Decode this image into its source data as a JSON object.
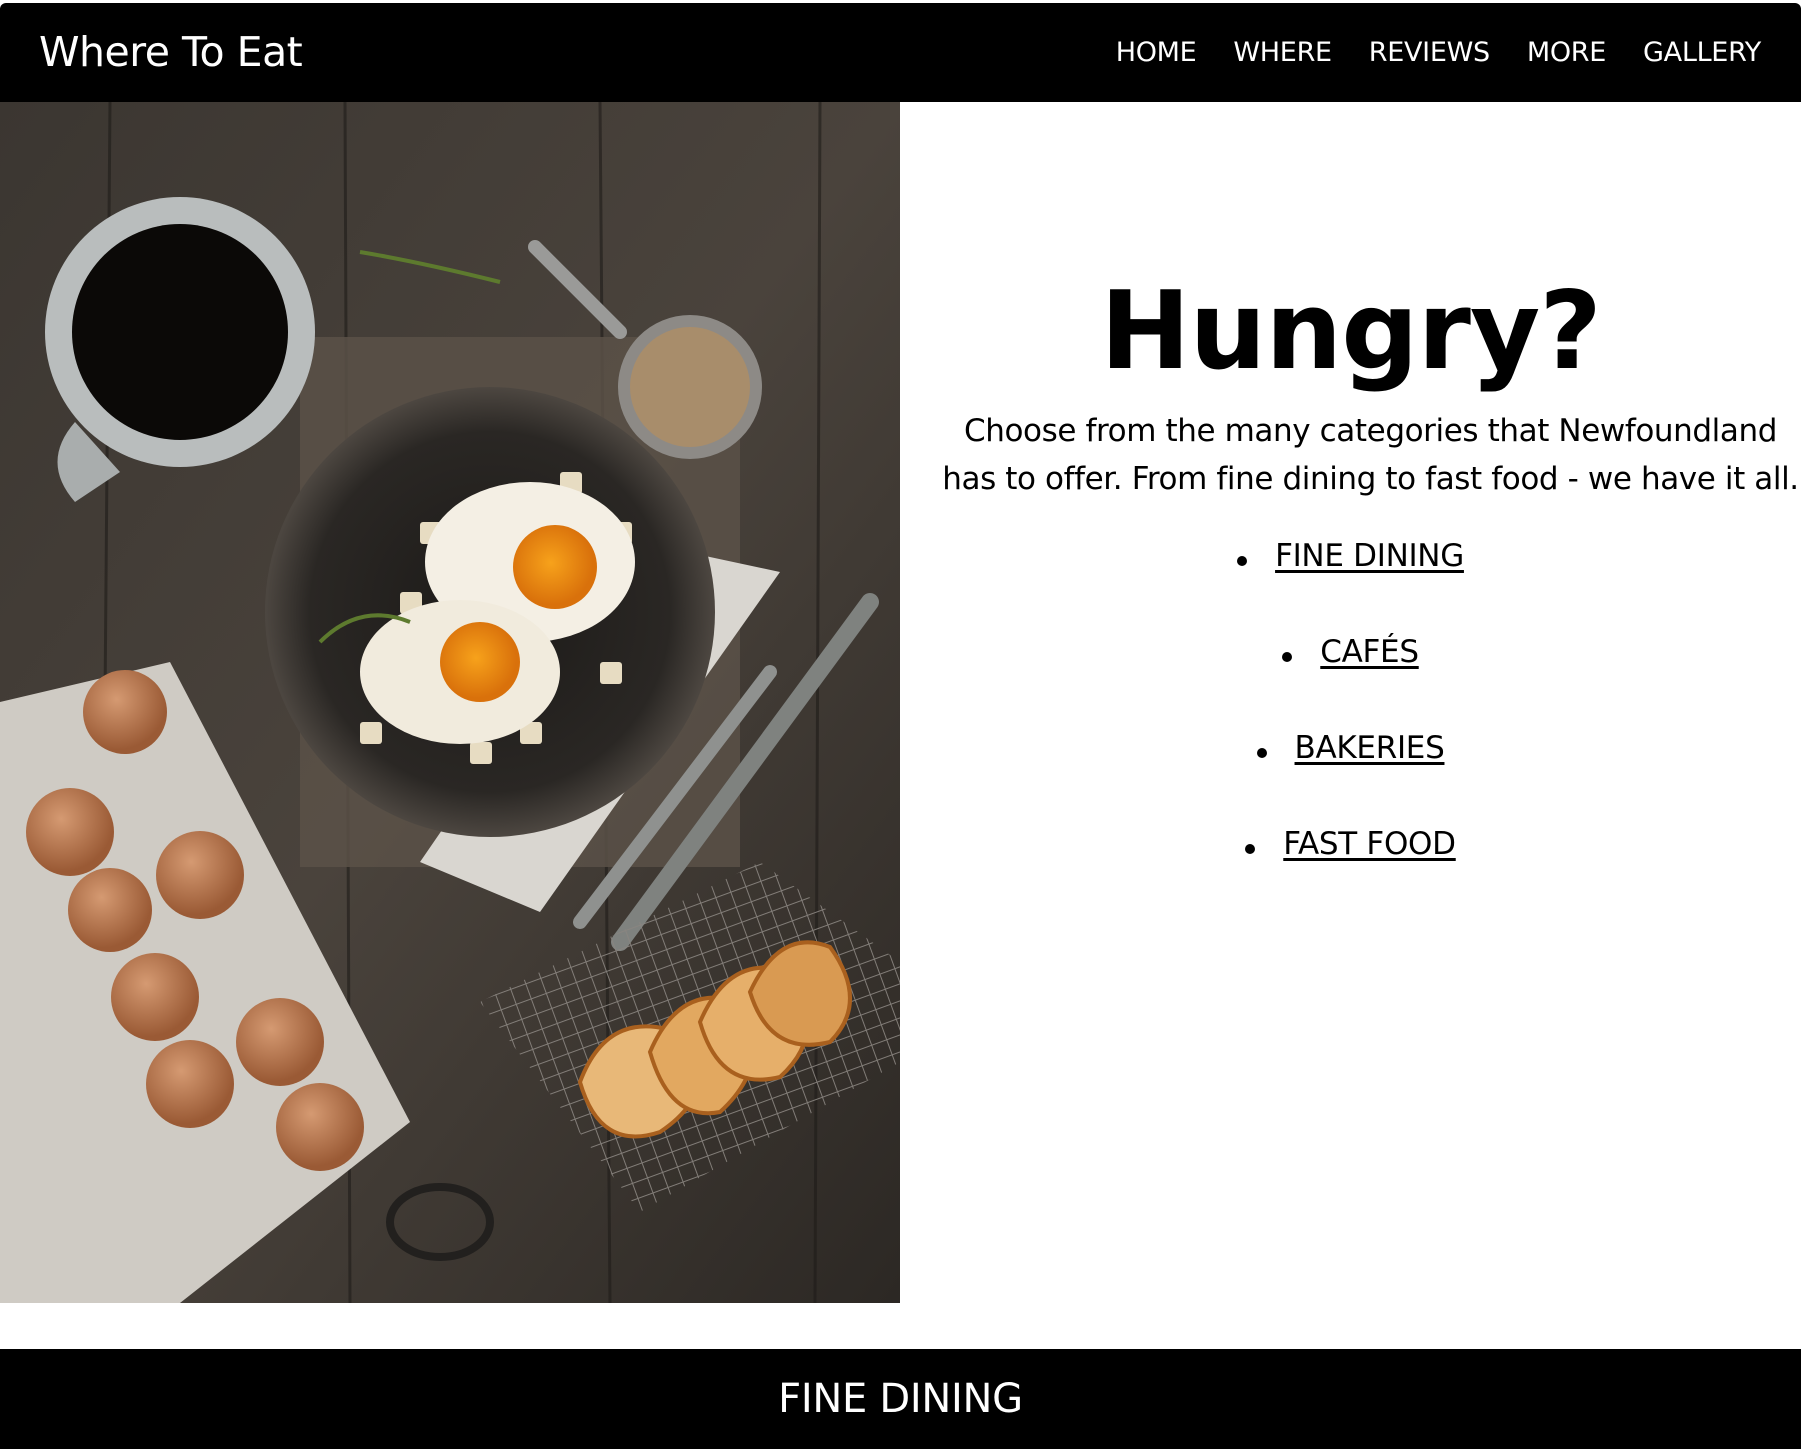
{
  "header": {
    "brand": "Where To Eat",
    "nav": [
      "HOME",
      "WHERE",
      "REVIEWS",
      "MORE",
      "GALLERY"
    ]
  },
  "hero": {
    "image_alt": "Breakfast table with eggs, coffee and toast",
    "title": "Hungry?",
    "text": "Choose from the many categories that Newfoundland has to offer. From fine dining to fast food - we have it all.",
    "categories": [
      "FINE DINING",
      "CAFÉS",
      "BAKERIES",
      "FAST FOOD"
    ]
  },
  "section": {
    "title": "FINE DINING"
  }
}
